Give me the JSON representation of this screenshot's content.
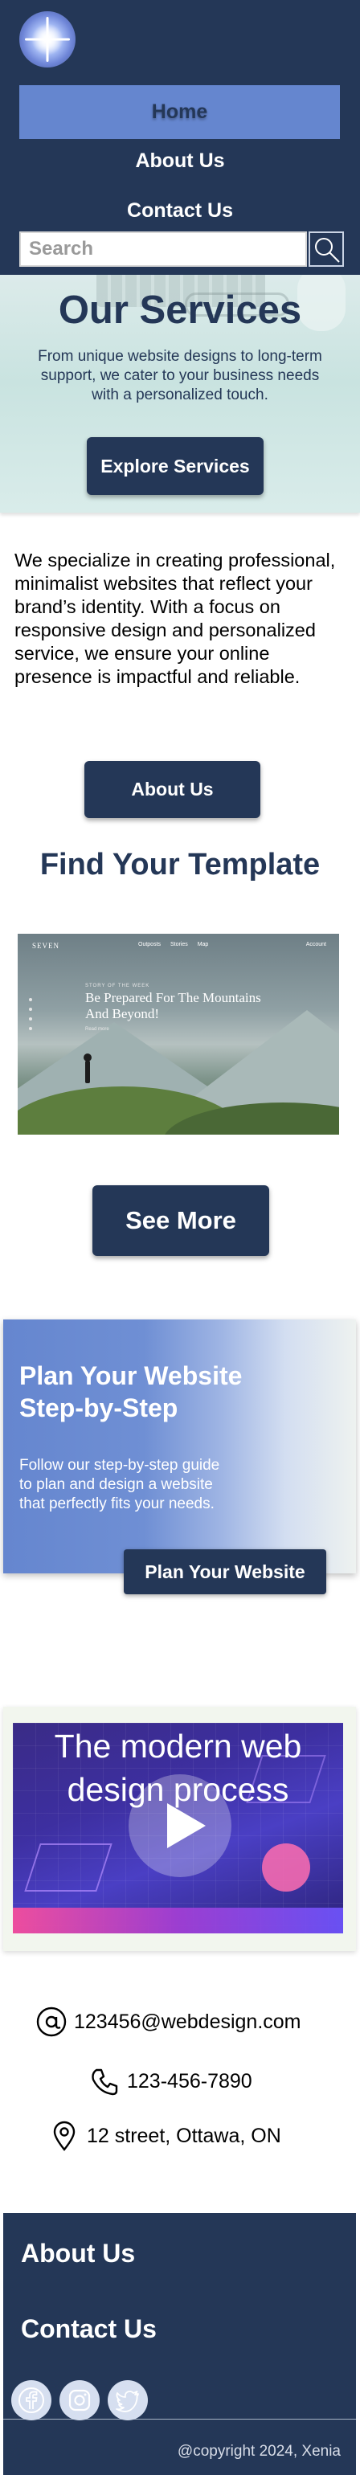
{
  "header": {
    "logo": "star-logo",
    "nav": {
      "home": "Home",
      "about": "About Us",
      "contact": "Contact Us"
    },
    "search": {
      "placeholder": "Search",
      "value": ""
    },
    "colors": {
      "navy": "#243757",
      "accent": "#6586cf"
    }
  },
  "hero": {
    "title": "Our Services",
    "subtitle": "From unique website designs to long-term support, we cater to your business needs with a personalized touch.",
    "button": "Explore Services"
  },
  "intro": {
    "text": "We specialize in creating professional, minimalist websites that reflect your brand’s identity. With a focus on responsive design and personalized service, we ensure your online presence is impactful and reliable.",
    "button": "About Us"
  },
  "templates": {
    "title": "Find Your Template",
    "preview": {
      "brand": "SEVEN",
      "nav": "Outposts Stories Map",
      "login": "Account",
      "kicker": "STORY OF THE WEEK",
      "heading": "Be Prepared For The Mountains And Beyond!",
      "read": "Read more"
    },
    "button": "See More"
  },
  "plan": {
    "title": "Plan Your Website Step-by-Step",
    "text": "Follow our step-by-step guide to plan and design a website that perfectly fits your needs.",
    "button": "Plan Your Website"
  },
  "video": {
    "title": "The modern web design process"
  },
  "contact": {
    "email": "123456@webdesign.com",
    "phone": "123-456-7890",
    "address": "12 street, Ottawa, ON"
  },
  "footer": {
    "about": "About Us",
    "contact": "Contact Us",
    "social": [
      "facebook-icon",
      "instagram-icon",
      "twitter-icon"
    ],
    "copyright": "@copyright 2024, Xenia"
  }
}
